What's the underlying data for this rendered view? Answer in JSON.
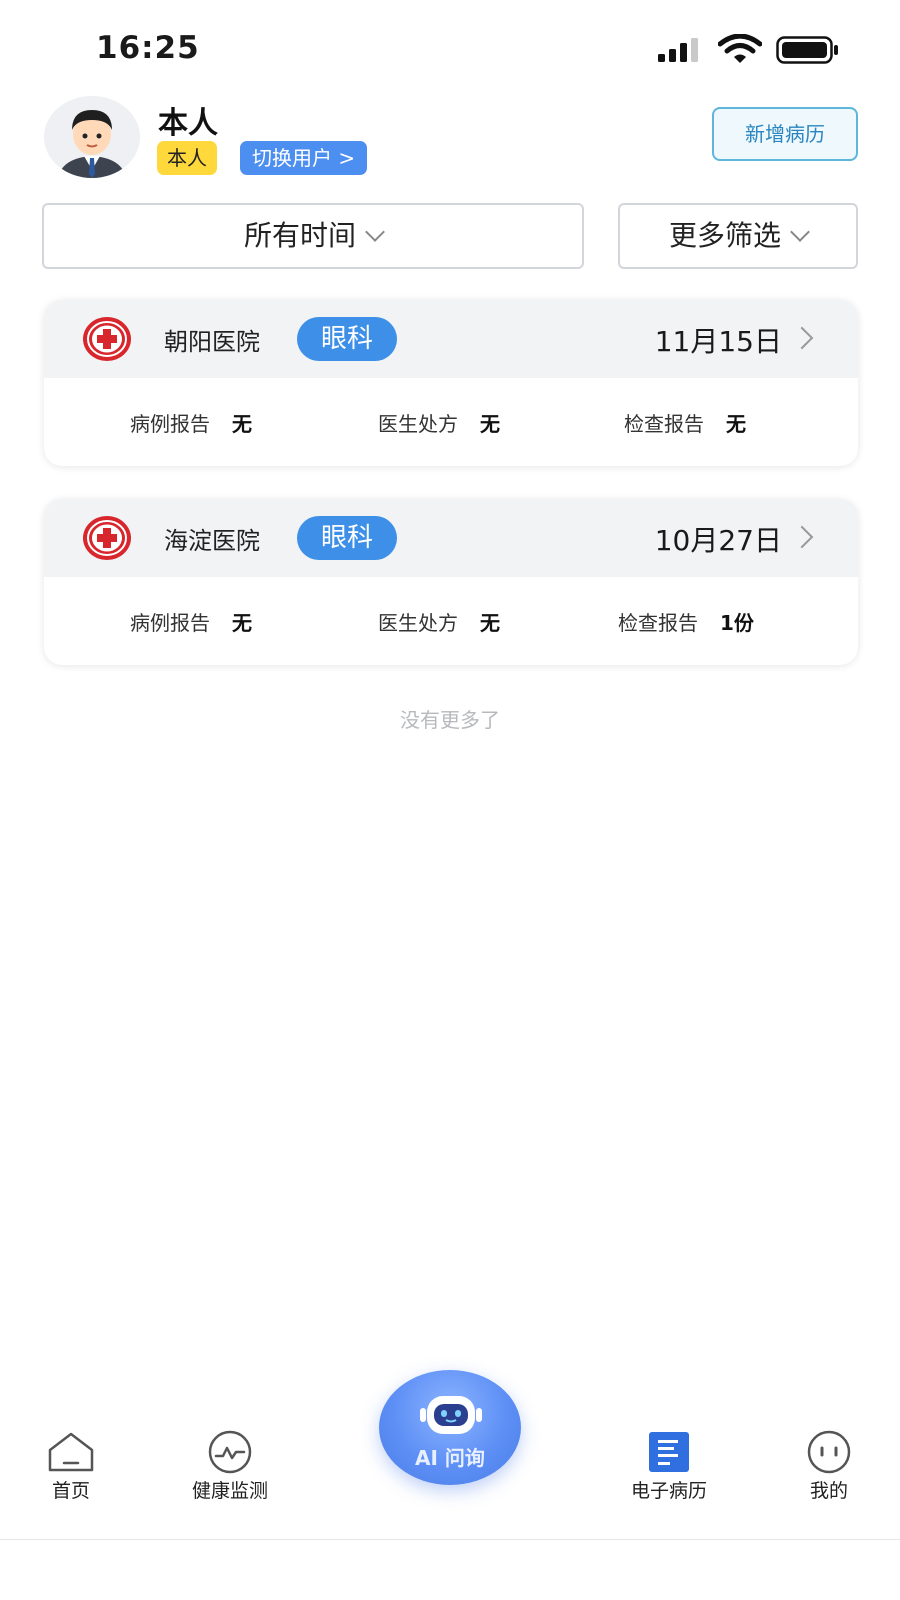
{
  "status_bar": {
    "time": "16:25"
  },
  "profile": {
    "name": "本人",
    "relation_tag": "本人",
    "switch_user_label": "切换用户 >"
  },
  "header_actions": {
    "add_record_label": "新增病历"
  },
  "filters": {
    "time_label": "所有时间",
    "more_label": "更多筛选"
  },
  "records": [
    {
      "hospital": "朝阳医院",
      "department": "眼科",
      "date": "11月15日",
      "stats": [
        {
          "label": "病例报告",
          "value": "无"
        },
        {
          "label": "医生处方",
          "value": "无"
        },
        {
          "label": "检查报告",
          "value": "无"
        }
      ]
    },
    {
      "hospital": "海淀医院",
      "department": "眼科",
      "date": "10月27日",
      "stats": [
        {
          "label": "病例报告",
          "value": "无"
        },
        {
          "label": "医生处方",
          "value": "无"
        },
        {
          "label": "检查报告",
          "value": "1份"
        }
      ]
    }
  ],
  "list_end_text": "没有更多了",
  "tab_bar": {
    "home": "首页",
    "health": "健康监测",
    "ai": "AI 问询",
    "records": "电子病历",
    "mine": "我的"
  },
  "colors": {
    "accent_blue": "#3d8fe8",
    "tag_yellow": "#ffd83b",
    "hospital_red": "#d8262d"
  },
  "icons": {
    "signal": "signal-icon",
    "wifi": "wifi-icon",
    "battery": "battery-icon",
    "hospital": "red-cross-icon",
    "home": "home-icon",
    "health": "heartbeat-icon",
    "ai": "robot-icon",
    "records": "document-icon",
    "mine": "face-icon"
  }
}
